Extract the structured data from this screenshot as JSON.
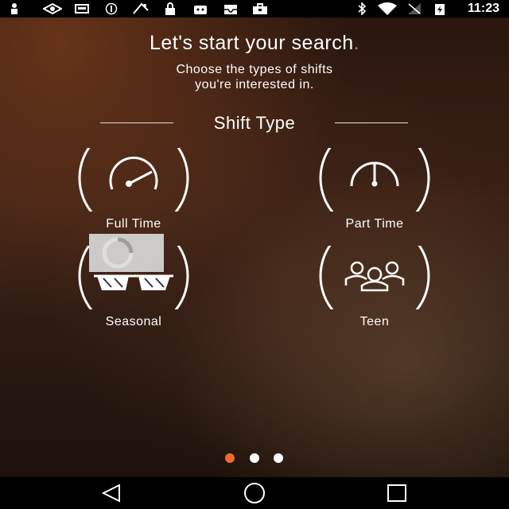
{
  "status_bar": {
    "icons": [
      "person-icon",
      "eye-icon",
      "storage-icon",
      "info-icon",
      "fps-icon",
      "lock-icon",
      "android-icon",
      "inbox-icon",
      "briefcase-icon",
      "bluetooth-icon",
      "wifi-icon",
      "no-signal-icon",
      "battery-charging-icon"
    ],
    "time": "11:23"
  },
  "header": {
    "title": "Let's start your search",
    "title_dot": ".",
    "subtitle_line1": "Choose the types of shifts",
    "subtitle_line2": "you're interested in."
  },
  "section": {
    "title": "Shift Type"
  },
  "options": [
    {
      "label": "Full Time",
      "icon": "speedometer-icon"
    },
    {
      "label": "Part Time",
      "icon": "gauge-icon"
    },
    {
      "label": "Seasonal",
      "icon": "sunglasses-icon"
    },
    {
      "label": "Teen",
      "icon": "group-icon"
    }
  ],
  "pager": {
    "active_index": 0,
    "count": 3,
    "active_color": "#f26b2a",
    "inactive_color": "#ffffff"
  },
  "colors": {
    "accent": "#f26b2a"
  },
  "nav_bar": {
    "icons": [
      "back-icon",
      "home-icon",
      "recents-icon"
    ]
  }
}
